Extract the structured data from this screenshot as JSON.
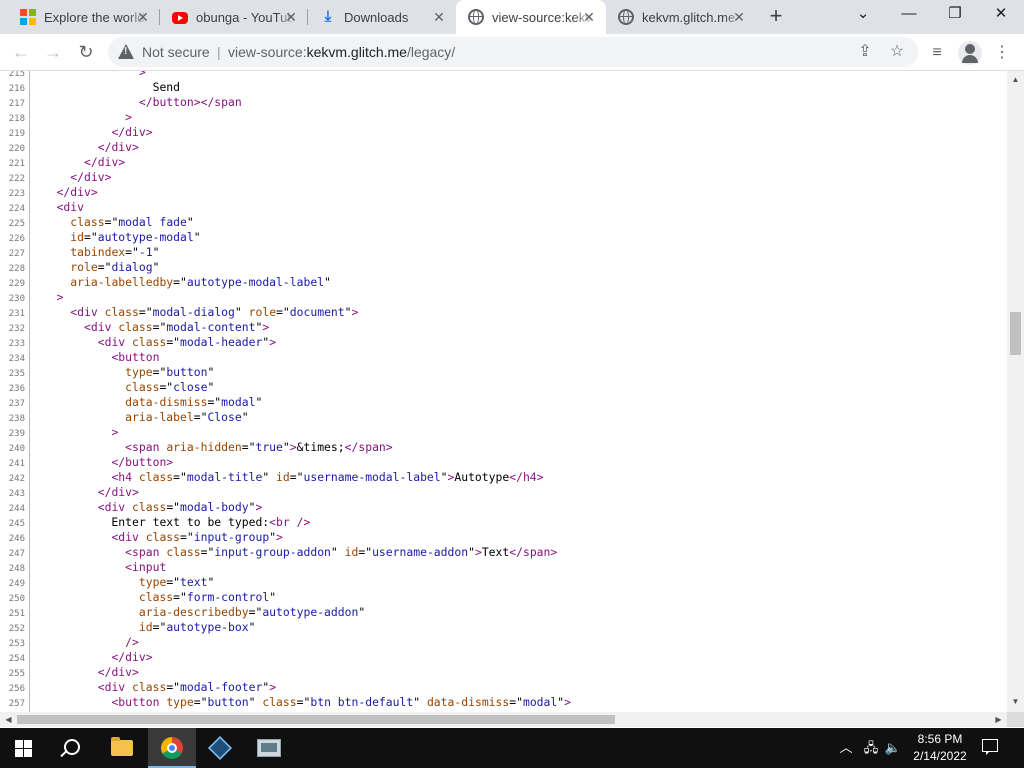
{
  "browser": {
    "tabs": [
      {
        "title": "Explore the world",
        "icon": "microsoft-logo-icon",
        "active": false
      },
      {
        "title": "obunga - YouTube",
        "icon": "youtube-icon",
        "active": false
      },
      {
        "title": "Downloads",
        "icon": "download-icon",
        "active": false
      },
      {
        "title": "view-source:kekvm.glitch.me/legacy/",
        "icon": "globe-icon",
        "active": true
      },
      {
        "title": "kekvm.glitch.me",
        "icon": "globe-icon",
        "active": false
      }
    ],
    "omnibox": {
      "security_label": "Not secure",
      "url_prefix": "view-source:",
      "url_host": "kekvm.glitch.me",
      "url_path": "/legacy/"
    }
  },
  "source": {
    "lines": [
      {
        "n": "215",
        "html": "               <span class=\"tg\">&gt;</span>"
      },
      {
        "n": "216",
        "html": "                 Send"
      },
      {
        "n": "217",
        "html": "               <span class=\"tg\">&lt;/button&gt;&lt;/span</span>"
      },
      {
        "n": "218",
        "html": "             <span class=\"tg\">&gt;</span>"
      },
      {
        "n": "219",
        "html": "           <span class=\"tg\">&lt;/div&gt;</span>"
      },
      {
        "n": "220",
        "html": "         <span class=\"tg\">&lt;/div&gt;</span>"
      },
      {
        "n": "221",
        "html": "       <span class=\"tg\">&lt;/div&gt;</span>"
      },
      {
        "n": "222",
        "html": "     <span class=\"tg\">&lt;/div&gt;</span>"
      },
      {
        "n": "223",
        "html": "   <span class=\"tg\">&lt;/div&gt;</span>"
      },
      {
        "n": "224",
        "html": "   <span class=\"tg\">&lt;div</span>"
      },
      {
        "n": "225",
        "html": "     <span class=\"at\">class</span>=\"<span class=\"av\">modal fade</span>\""
      },
      {
        "n": "226",
        "html": "     <span class=\"at\">id</span>=\"<span class=\"av\">autotype-modal</span>\""
      },
      {
        "n": "227",
        "html": "     <span class=\"at\">tabindex</span>=\"<span class=\"av\">-1</span>\""
      },
      {
        "n": "228",
        "html": "     <span class=\"at\">role</span>=\"<span class=\"av\">dialog</span>\""
      },
      {
        "n": "229",
        "html": "     <span class=\"at\">aria-labelledby</span>=\"<span class=\"av\">autotype-modal-label</span>\""
      },
      {
        "n": "230",
        "html": "   <span class=\"tg\">&gt;</span>"
      },
      {
        "n": "231",
        "html": "     <span class=\"tg\">&lt;div </span><span class=\"at\">class</span>=\"<span class=\"av\">modal-dialog</span>\" <span class=\"at\">role</span>=\"<span class=\"av\">document</span>\"<span class=\"tg\">&gt;</span>"
      },
      {
        "n": "232",
        "html": "       <span class=\"tg\">&lt;div </span><span class=\"at\">class</span>=\"<span class=\"av\">modal-content</span>\"<span class=\"tg\">&gt;</span>"
      },
      {
        "n": "233",
        "html": "         <span class=\"tg\">&lt;div </span><span class=\"at\">class</span>=\"<span class=\"av\">modal-header</span>\"<span class=\"tg\">&gt;</span>"
      },
      {
        "n": "234",
        "html": "           <span class=\"tg\">&lt;button</span>"
      },
      {
        "n": "235",
        "html": "             <span class=\"at\">type</span>=\"<span class=\"av\">button</span>\""
      },
      {
        "n": "236",
        "html": "             <span class=\"at\">class</span>=\"<span class=\"av\">close</span>\""
      },
      {
        "n": "237",
        "html": "             <span class=\"at\">data-dismiss</span>=\"<span class=\"av\">modal</span>\""
      },
      {
        "n": "238",
        "html": "             <span class=\"at\">aria-label</span>=\"<span class=\"av\">Close</span>\""
      },
      {
        "n": "239",
        "html": "           <span class=\"tg\">&gt;</span>"
      },
      {
        "n": "240",
        "html": "             <span class=\"tg\">&lt;span </span><span class=\"at\">aria-hidden</span>=\"<span class=\"av\">true</span>\"<span class=\"tg\">&gt;</span>&amp;times;<span class=\"tg\">&lt;/span&gt;</span>"
      },
      {
        "n": "241",
        "html": "           <span class=\"tg\">&lt;/button&gt;</span>"
      },
      {
        "n": "242",
        "html": "           <span class=\"tg\">&lt;h4 </span><span class=\"at\">class</span>=\"<span class=\"av\">modal-title</span>\" <span class=\"at\">id</span>=\"<span class=\"av\">username-modal-label</span>\"<span class=\"tg\">&gt;</span>Autotype<span class=\"tg\">&lt;/h4&gt;</span>"
      },
      {
        "n": "243",
        "html": "         <span class=\"tg\">&lt;/div&gt;</span>"
      },
      {
        "n": "244",
        "html": "         <span class=\"tg\">&lt;div </span><span class=\"at\">class</span>=\"<span class=\"av\">modal-body</span>\"<span class=\"tg\">&gt;</span>"
      },
      {
        "n": "245",
        "html": "           Enter text to be typed:<span class=\"tg\">&lt;br /&gt;</span>"
      },
      {
        "n": "246",
        "html": "           <span class=\"tg\">&lt;div </span><span class=\"at\">class</span>=\"<span class=\"av\">input-group</span>\"<span class=\"tg\">&gt;</span>"
      },
      {
        "n": "247",
        "html": "             <span class=\"tg\">&lt;span </span><span class=\"at\">class</span>=\"<span class=\"av\">input-group-addon</span>\" <span class=\"at\">id</span>=\"<span class=\"av\">username-addon</span>\"<span class=\"tg\">&gt;</span>Text<span class=\"tg\">&lt;/span&gt;</span>"
      },
      {
        "n": "248",
        "html": "             <span class=\"tg\">&lt;input</span>"
      },
      {
        "n": "249",
        "html": "               <span class=\"at\">type</span>=\"<span class=\"av\">text</span>\""
      },
      {
        "n": "250",
        "html": "               <span class=\"at\">class</span>=\"<span class=\"av\">form-control</span>\""
      },
      {
        "n": "251",
        "html": "               <span class=\"at\">aria-describedby</span>=\"<span class=\"av\">autotype-addon</span>\""
      },
      {
        "n": "252",
        "html": "               <span class=\"at\">id</span>=\"<span class=\"av\">autotype-box</span>\""
      },
      {
        "n": "253",
        "html": "             <span class=\"tg\">/&gt;</span>"
      },
      {
        "n": "254",
        "html": "           <span class=\"tg\">&lt;/div&gt;</span>"
      },
      {
        "n": "255",
        "html": "         <span class=\"tg\">&lt;/div&gt;</span>"
      },
      {
        "n": "256",
        "html": "         <span class=\"tg\">&lt;div </span><span class=\"at\">class</span>=\"<span class=\"av\">modal-footer</span>\"<span class=\"tg\">&gt;</span>"
      },
      {
        "n": "257",
        "html": "           <span class=\"tg\">&lt;button </span><span class=\"at\">type</span>=\"<span class=\"av\">button</span>\" <span class=\"at\">class</span>=\"<span class=\"av\">btn btn-default</span>\" <span class=\"at\">data-dismiss</span>=\"<span class=\"av\">modal</span>\"<span class=\"tg\">&gt;</span>"
      }
    ]
  },
  "taskbar": {
    "clock_time": "8:56 PM",
    "clock_date": "2/14/2022",
    "apps": [
      "start-button",
      "search-button",
      "file-explorer",
      "chrome",
      "virtualbox",
      "remote-display-app"
    ]
  },
  "colors": {
    "tabstrip_bg": "#dee1e6",
    "tag_color": "#881280",
    "attr_name_color": "#994500",
    "attr_value_color": "#1a1aa6"
  }
}
